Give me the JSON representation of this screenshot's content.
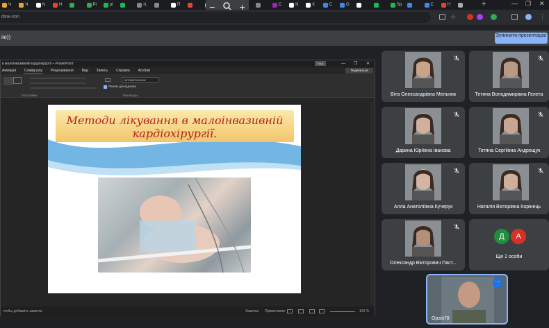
{
  "browser": {
    "tabs": [
      {
        "letter": "Ч",
        "color": "#e8a33d"
      },
      {
        "letter": "Ч",
        "color": "#e8a33d"
      },
      {
        "letter": "N",
        "color": "#ffffff"
      },
      {
        "letter": "H",
        "color": "#ea4335"
      },
      {
        "letter": "",
        "color": "#34a853"
      },
      {
        "letter": "Pl",
        "color": "#34a853"
      },
      {
        "letter": "pl",
        "color": "#1db954"
      },
      {
        "letter": "",
        "color": "#1db954"
      },
      {
        "letter": "rL",
        "color": "#888888"
      },
      {
        "letter": "",
        "color": "#888888"
      },
      {
        "letter": "П",
        "color": "#ffffff"
      },
      {
        "letter": "",
        "color": "#ea4335"
      },
      {
        "letter": "U",
        "color": "#fbbc04"
      },
      {
        "letter": "",
        "color": "#1877f2"
      },
      {
        "letter": "Pl",
        "color": "#34a853"
      },
      {
        "letter": "",
        "color": "#888888"
      },
      {
        "letter": "C",
        "color": "#9c27b0"
      },
      {
        "letter": "N",
        "color": "#ffffff"
      },
      {
        "letter": "К",
        "color": "#ffffff"
      },
      {
        "letter": "C",
        "color": "#4285f4"
      },
      {
        "letter": "G",
        "color": "#4285f4"
      },
      {
        "letter": "",
        "color": "#ffffff"
      },
      {
        "letter": "",
        "color": "#1db954"
      },
      {
        "letter": "Sp",
        "color": "#1db954"
      },
      {
        "letter": "",
        "color": "#4285f4"
      },
      {
        "letter": "C",
        "color": "#4285f4"
      },
      {
        "letter": "H",
        "color": "#ea4335"
      },
      {
        "letter": "",
        "color": "#aaaaaa"
      }
    ],
    "url_fragment": "dvw-von",
    "zoom_minus": "−",
    "zoom_plus": "+",
    "new_tab": "+"
  },
  "meet": {
    "presenting_label": "ію))",
    "stop_button": "Зупинити презентацію"
  },
  "powerpoint": {
    "window_title": "в малоінвазивній кардіохірургії – PowerPoint",
    "in_badge": "Вхід",
    "menu": [
      "Анімація",
      "Слайд-шоу",
      "Рецензування",
      "Вид",
      "Запись",
      "Справка",
      "Acrobat"
    ],
    "active_menu": "Слайд-шоу",
    "share": "Поделиться",
    "ribbon_group1": "Настройка",
    "ribbon_group2": "Мониторы",
    "ribbon_monitor_value": "Автоматически",
    "ribbon_checkbox": "Режим докладчика",
    "status_notes": "чтобы добавить заметки",
    "status_items": [
      "Заметки",
      "Примечания"
    ],
    "zoom_level": "100 %"
  },
  "slide": {
    "title_line1": "Методи лікування в малоінвазивній",
    "title_line2": "кардіохірургії."
  },
  "participants": [
    {
      "name": "Віта Олександрівна Мельник"
    },
    {
      "name": "Тетяна Володимирівна Гелета"
    },
    {
      "name": "Дарина Юріївна Іванова"
    },
    {
      "name": "Тетяна Сергіївна Андрощук"
    },
    {
      "name": "Алла Анатоліївна Кучерук"
    },
    {
      "name": "Наталія Вікторівна Корінець"
    },
    {
      "name": "Олександр Вікторович Паст..."
    }
  ],
  "more_participants": {
    "avatars": [
      {
        "letter": "Д",
        "color": "#1e8e3e"
      },
      {
        "letter": "А",
        "color": "#d93025"
      }
    ],
    "label": "Ще 2 особи"
  },
  "self_view": {
    "name": "Opsis78",
    "more_icon": "⋯"
  }
}
